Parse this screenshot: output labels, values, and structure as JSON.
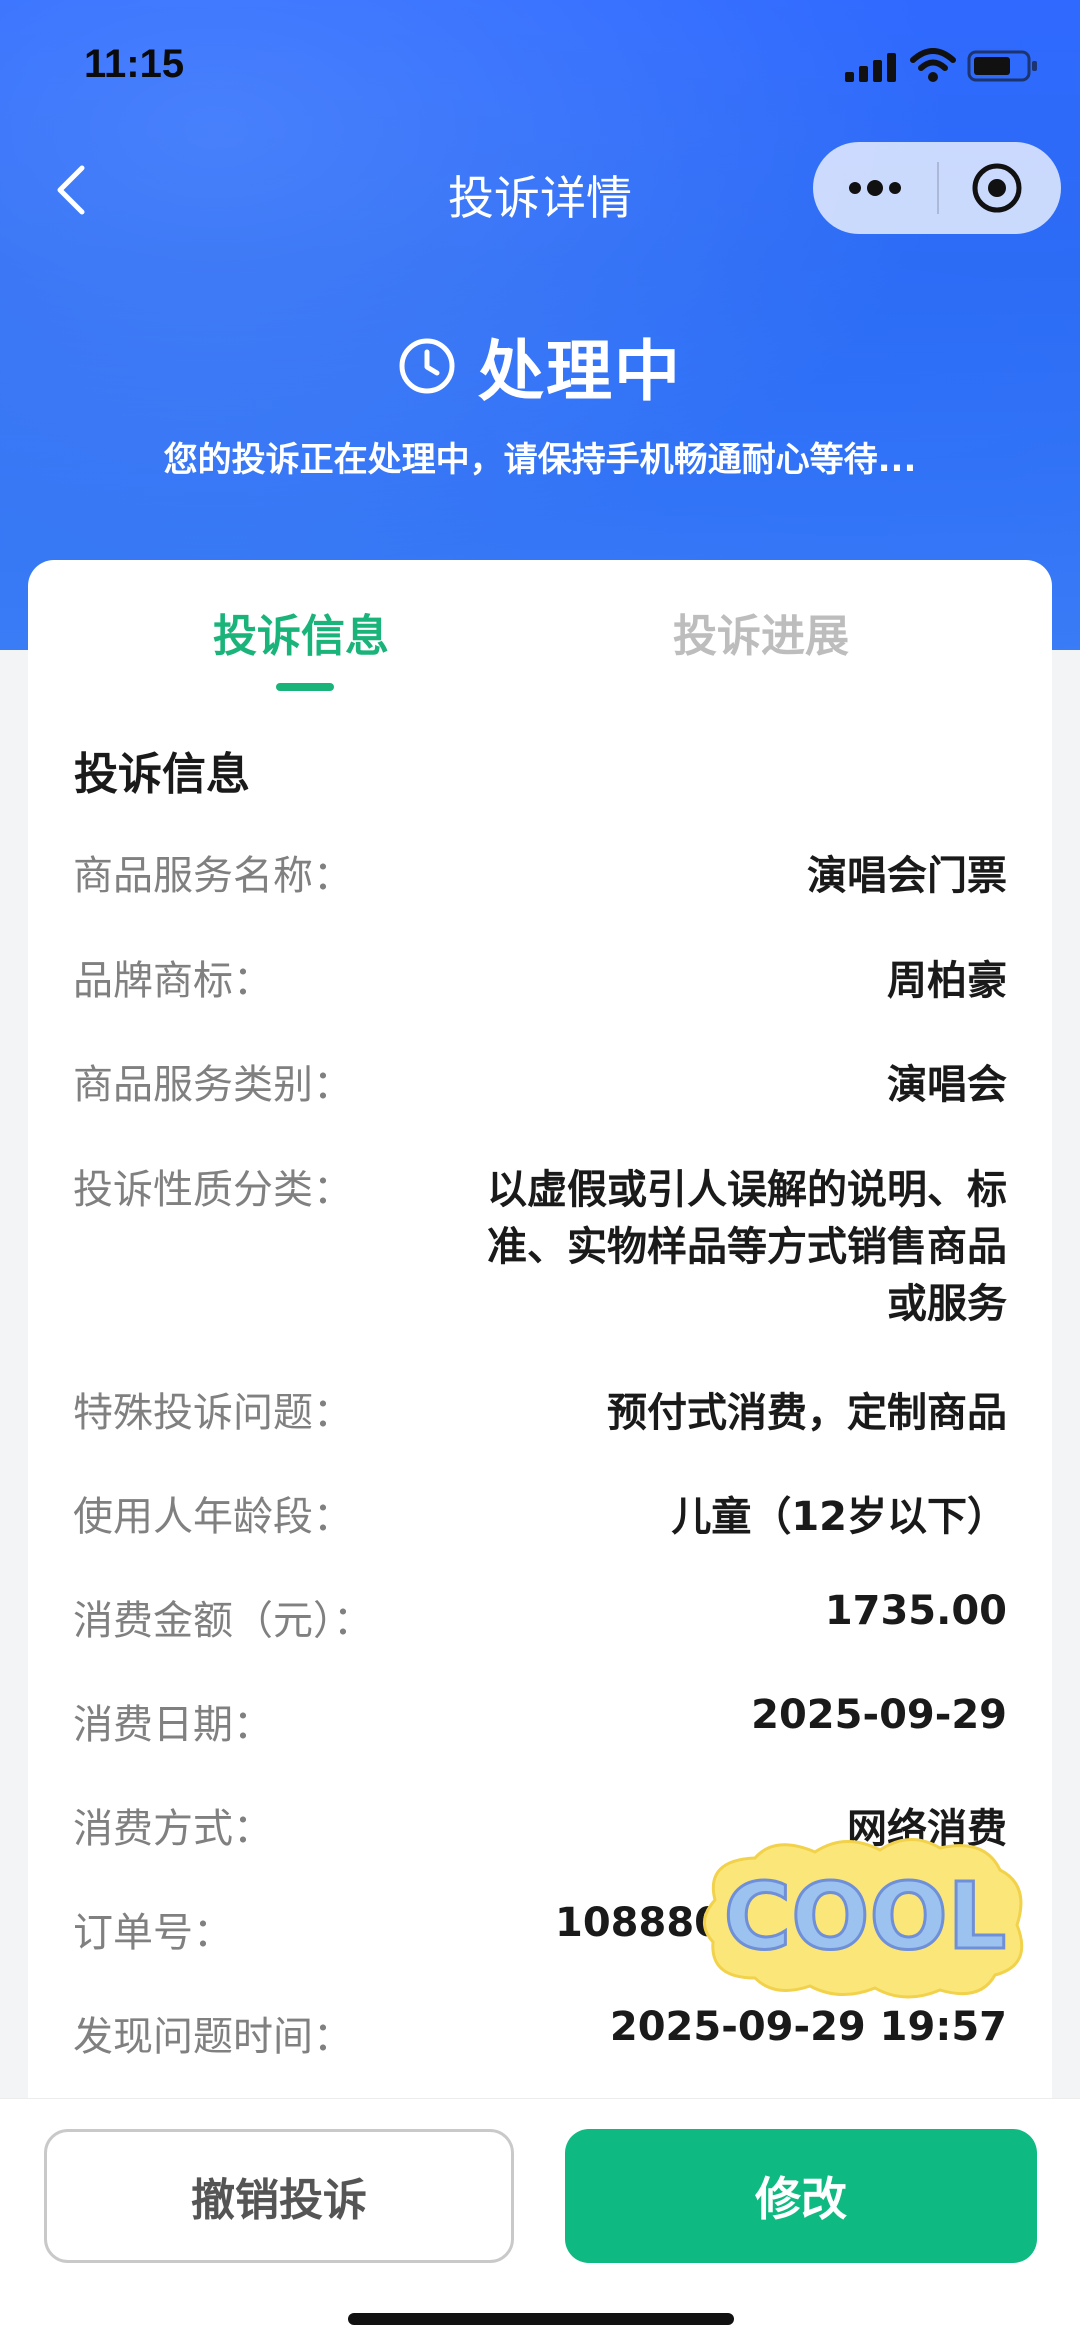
{
  "status_bar": {
    "time": "11:15"
  },
  "nav": {
    "title": "投诉详情"
  },
  "state": {
    "title": "处理中",
    "description": "您的投诉正在处理中，请保持手机畅通耐心等待..."
  },
  "tabs": [
    {
      "label": "投诉信息",
      "active": true
    },
    {
      "label": "投诉进展",
      "active": false
    }
  ],
  "section": {
    "title": "投诉信息"
  },
  "rows": [
    {
      "label": "商品服务名称：",
      "value": [
        "演唱会门票"
      ]
    },
    {
      "label": "品牌商标：",
      "value": [
        "周柏豪"
      ]
    },
    {
      "label": "商品服务类别：",
      "value": [
        "演唱会"
      ]
    },
    {
      "label": "投诉性质分类：",
      "value": [
        "以虚假或引人误解的说明、标",
        "准、实物样品等方式销售商品",
        "或服务"
      ]
    },
    {
      "label": "特殊投诉问题：",
      "value": [
        "预付式消费，定制商品"
      ]
    },
    {
      "label": "使用人年龄段：",
      "value": [
        "儿童（12岁以下）"
      ]
    },
    {
      "label": "消费金额（元）：",
      "value": [
        "1735.00"
      ]
    },
    {
      "label": "消费日期：",
      "value": [
        "2025-09-29"
      ]
    },
    {
      "label": "消费方式：",
      "value": [
        "网络消费"
      ]
    },
    {
      "label": "订单号：",
      "value": [
        "108880"
      ]
    },
    {
      "label": "发现问题时间：",
      "value": [
        "2025-09-29 19:57"
      ]
    }
  ],
  "sticker": {
    "text": "COOL"
  },
  "buttons": {
    "cancel": "撤销投诉",
    "edit": "修改"
  },
  "colors": {
    "accent": "#1ab47b",
    "header": "#2f69ff",
    "primary_button": "#0fba82"
  },
  "icons": [
    "back-icon",
    "more-icon",
    "target-icon",
    "clock-icon",
    "signal-icon",
    "wifi-icon",
    "battery-icon"
  ]
}
